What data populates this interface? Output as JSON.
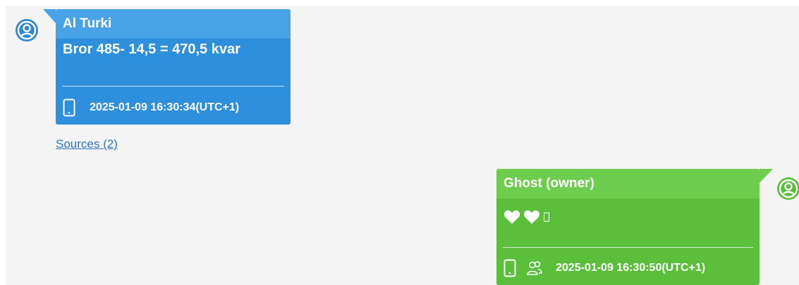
{
  "messages": [
    {
      "sender": "Al Turki",
      "text": "Bror 485- 14,5 = 470,5 kvar",
      "timestamp": "2025-01-09 16:30:34(UTC+1)",
      "footer_icons": [
        "phone-icon"
      ],
      "colors": {
        "bubble": "#2e8fdd",
        "header": "#47a2e6"
      }
    },
    {
      "sender": "Ghost (owner)",
      "content_icons": [
        "heart-icon",
        "heart-icon",
        "unknown-glyph-box"
      ],
      "timestamp": "2025-01-09 16:30:50(UTC+1)",
      "footer_icons": [
        "phone-icon",
        "group-icon"
      ],
      "colors": {
        "bubble": "#5cbf3b",
        "header": "#6fcd4e"
      }
    }
  ],
  "sources_link": "Sources (2)"
}
